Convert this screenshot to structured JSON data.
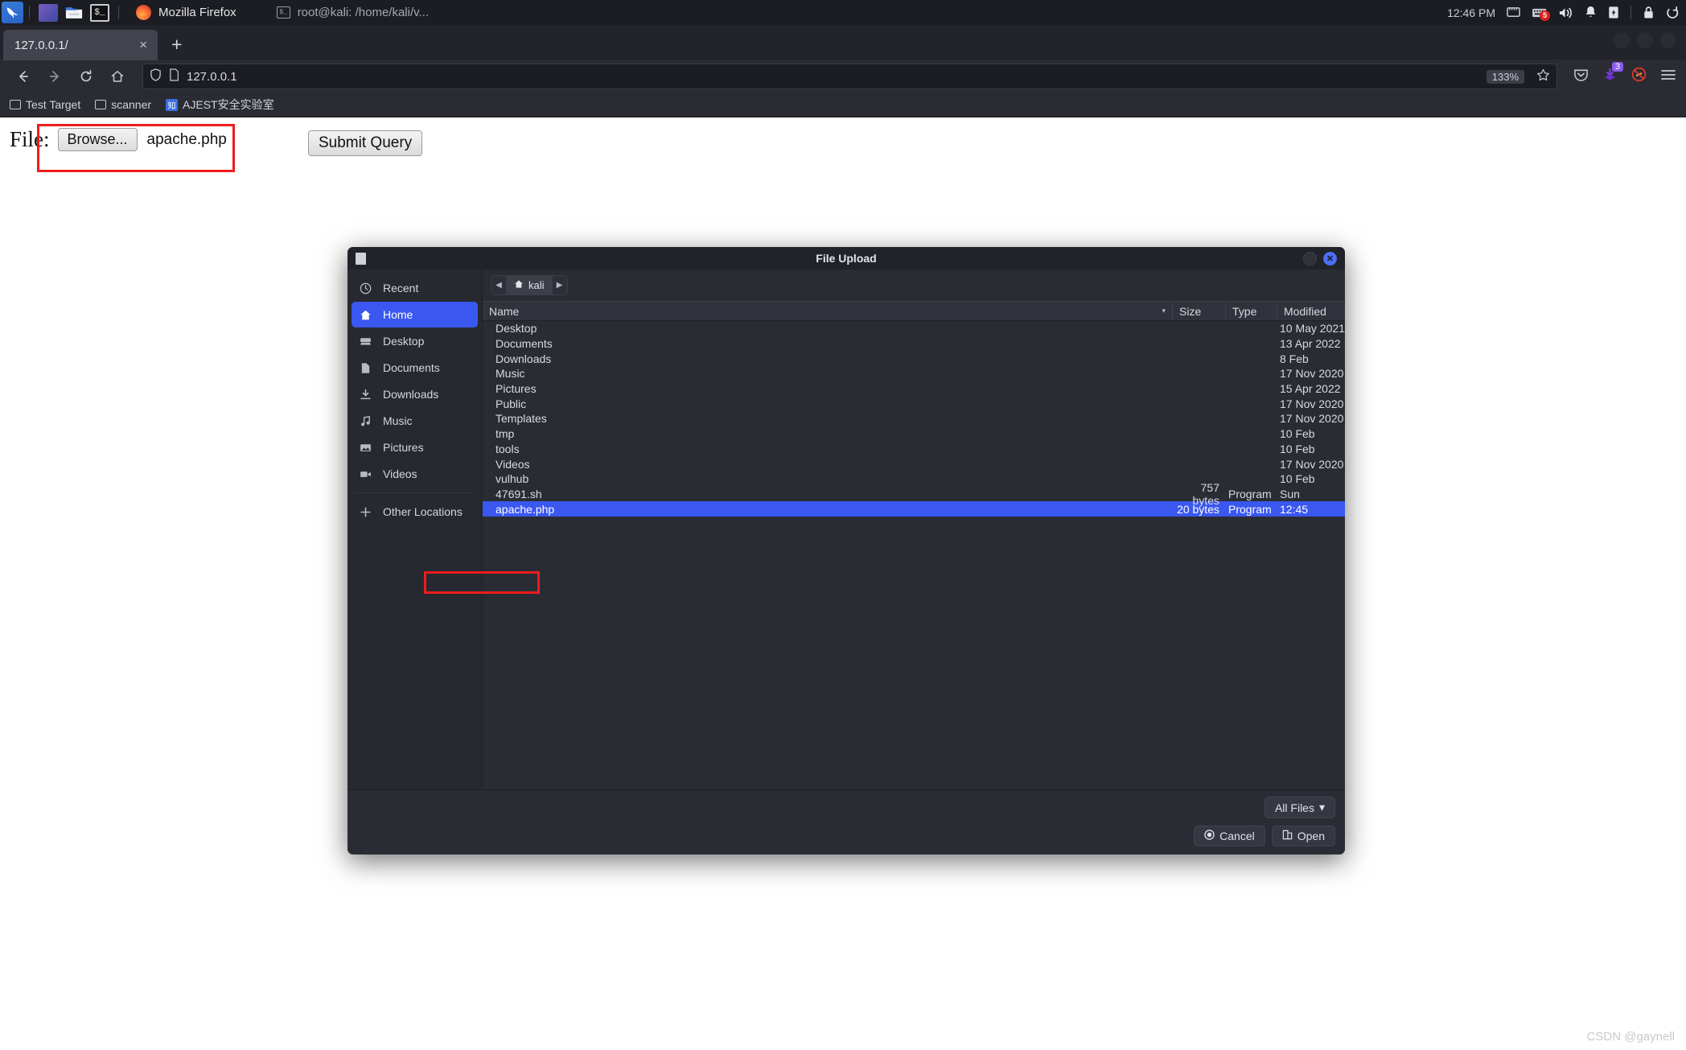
{
  "taskbar": {
    "logo": "kali-dragon",
    "launchers": [
      {
        "name": "display-settings-icon",
        "label": "Display"
      },
      {
        "name": "file-manager-icon",
        "label": "Files"
      },
      {
        "name": "terminal-icon",
        "label": "$_"
      }
    ],
    "windows": [
      {
        "name": "firefox-window",
        "label": "Mozilla Firefox",
        "icon": "firefox-icon"
      },
      {
        "name": "terminal-window",
        "label": "root@kali: /home/kali/v...",
        "icon": "terminal-icon"
      }
    ],
    "clock": "12:46 PM",
    "tray": [
      "display-icon",
      "keyboard-icon",
      "volume-icon",
      "notification-icon",
      "battery-icon",
      "lock-icon",
      "logout-icon"
    ],
    "keyboard_badge": "5"
  },
  "browser": {
    "tab": {
      "title": "127.0.0.1/",
      "close": "×"
    },
    "new_tab": "+",
    "nav": {
      "back": "←",
      "forward": "→",
      "reload": "↻",
      "home": "⌂"
    },
    "urlbar": {
      "value": "127.0.0.1",
      "shield": "shield-icon",
      "page": "page-icon",
      "zoom": "133%",
      "bookmark": "star-icon"
    },
    "toolbar_right": [
      "pocket-icon",
      "downloads-icon",
      "noscript-icon",
      "menu-icon"
    ],
    "downloads_badge": "3",
    "bookmarks": [
      {
        "label": "Test Target",
        "icon": "folder-icon"
      },
      {
        "label": "scanner",
        "icon": "folder-icon"
      },
      {
        "label": "AJEST安全实验室",
        "icon": "zhi-icon"
      }
    ]
  },
  "page": {
    "file_label": "File:",
    "browse_button": "Browse...",
    "selected_file": "apache.php",
    "submit_button": "Submit Query"
  },
  "dialog": {
    "title": "File Upload",
    "titlebar_buttons": {
      "minimize": "",
      "close": "✕"
    },
    "sidebar": [
      {
        "label": "Recent",
        "icon": "clock-icon",
        "active": false
      },
      {
        "label": "Home",
        "icon": "home-icon",
        "active": true
      },
      {
        "label": "Desktop",
        "icon": "desktop-icon",
        "active": false
      },
      {
        "label": "Documents",
        "icon": "document-icon",
        "active": false
      },
      {
        "label": "Downloads",
        "icon": "download-icon",
        "active": false
      },
      {
        "label": "Music",
        "icon": "music-icon",
        "active": false
      },
      {
        "label": "Pictures",
        "icon": "picture-icon",
        "active": false
      },
      {
        "label": "Videos",
        "icon": "video-icon",
        "active": false
      },
      {
        "label": "Other Locations",
        "icon": "plus-icon",
        "active": false
      }
    ],
    "path": {
      "crumb": "kali",
      "home_icon": "home-icon",
      "prev": "◀",
      "next": "▶"
    },
    "columns": {
      "name": "Name",
      "size": "Size",
      "type": "Type",
      "modified": "Modified",
      "sort": "▾"
    },
    "files": [
      {
        "name": "Desktop",
        "size": "",
        "type": "",
        "modified": "10 May 2021",
        "icon": "folder-icon",
        "kind": "folder-purple",
        "selected": false
      },
      {
        "name": "Documents",
        "size": "",
        "type": "",
        "modified": "13 Apr 2022",
        "icon": "folder-icon",
        "kind": "folder",
        "selected": false
      },
      {
        "name": "Downloads",
        "size": "",
        "type": "",
        "modified": "8 Feb",
        "icon": "folder-icon",
        "kind": "folder",
        "selected": false
      },
      {
        "name": "Music",
        "size": "",
        "type": "",
        "modified": "17 Nov 2020",
        "icon": "folder-icon",
        "kind": "folder",
        "selected": false
      },
      {
        "name": "Pictures",
        "size": "",
        "type": "",
        "modified": "15 Apr 2022",
        "icon": "folder-icon",
        "kind": "folder",
        "selected": false
      },
      {
        "name": "Public",
        "size": "",
        "type": "",
        "modified": "17 Nov 2020",
        "icon": "folder-icon",
        "kind": "folder",
        "selected": false
      },
      {
        "name": "Templates",
        "size": "",
        "type": "",
        "modified": "17 Nov 2020",
        "icon": "folder-icon",
        "kind": "folder",
        "selected": false
      },
      {
        "name": "tmp",
        "size": "",
        "type": "",
        "modified": "10 Feb",
        "icon": "folder-icon",
        "kind": "folder",
        "selected": false
      },
      {
        "name": "tools",
        "size": "",
        "type": "",
        "modified": "10 Feb",
        "icon": "folder-icon",
        "kind": "folder",
        "selected": false
      },
      {
        "name": "Videos",
        "size": "",
        "type": "",
        "modified": "17 Nov 2020",
        "icon": "folder-icon",
        "kind": "folder",
        "selected": false
      },
      {
        "name": "vulhub",
        "size": "",
        "type": "",
        "modified": "10 Feb",
        "icon": "folder-icon",
        "kind": "folder",
        "selected": false
      },
      {
        "name": "47691.sh",
        "size": "757 bytes",
        "type": "Program",
        "modified": "Sun",
        "icon": "script-file-icon",
        "kind": "script",
        "selected": false
      },
      {
        "name": "apache.php",
        "size": "20 bytes",
        "type": "Program",
        "modified": "12:45",
        "icon": "php-file-icon",
        "kind": "php",
        "selected": true
      }
    ],
    "filter": {
      "label": "All Files",
      "caret": "▾"
    },
    "cancel_button": "Cancel",
    "open_button": "Open"
  },
  "watermark": "CSDN @gaynell",
  "annotations": {
    "highlight_color": "#ee1c1c",
    "boxes": [
      "file-input-highlight",
      "apache-php-row-highlight"
    ]
  }
}
